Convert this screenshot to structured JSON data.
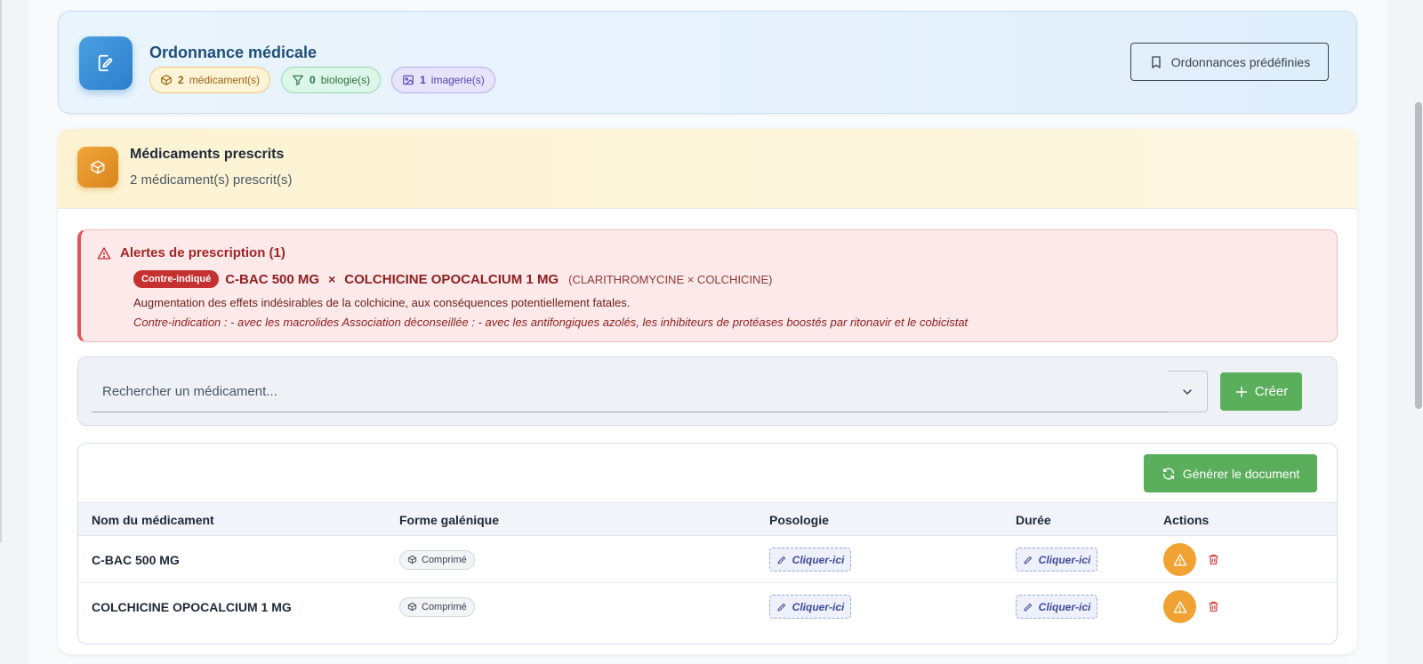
{
  "header": {
    "title": "Ordonnance médicale",
    "badges": {
      "med_count": "2",
      "med_label": "médicament(s)",
      "bio_count": "0",
      "bio_label": "biologie(s)",
      "img_count": "1",
      "img_label": "imagerie(s)"
    },
    "predef_label": "Ordonnances prédéfinies"
  },
  "meds_section": {
    "title": "Médicaments prescrits",
    "subtitle": "2 médicament(s) prescrit(s)"
  },
  "alert": {
    "title": "Alertes de prescription (1)",
    "badge": "Contre-indiqué",
    "drug_a": "C-BAC 500 MG",
    "times": "×",
    "drug_b": "COLCHICINE OPOCALCIUM 1 MG",
    "inn": "(CLARITHROMYCINE × COLCHICINE)",
    "description": "Augmentation des effets indésirables de la colchicine, aux conséquences potentiellement fatales.",
    "detail": "Contre-indication : - avec les macrolides Association déconseillée : - avec les antifongiques azolés, les inhibiteurs de protéases boostés par ritonavir et le cobicistat"
  },
  "search": {
    "placeholder": "Rechercher un médicament...",
    "create_label": "Créer"
  },
  "table": {
    "generate_label": "Générer le document",
    "columns": [
      "Nom du médicament",
      "Forme galénique",
      "Posologie",
      "Durée",
      "Actions"
    ],
    "rows": [
      {
        "name": "C-BAC 500 MG",
        "form": "Comprimé",
        "posologie": "Cliquer-ici",
        "duree": "Cliquer-ici"
      },
      {
        "name": "COLCHICINE OPOCALCIUM 1 MG",
        "form": "Comprimé",
        "posologie": "Cliquer-ici",
        "duree": "Cliquer-ici"
      }
    ]
  },
  "colors": {
    "primary_blue": "#2c7fcc",
    "orange": "#f0a232",
    "green": "#5aae5c",
    "alert_red": "#c53030"
  }
}
